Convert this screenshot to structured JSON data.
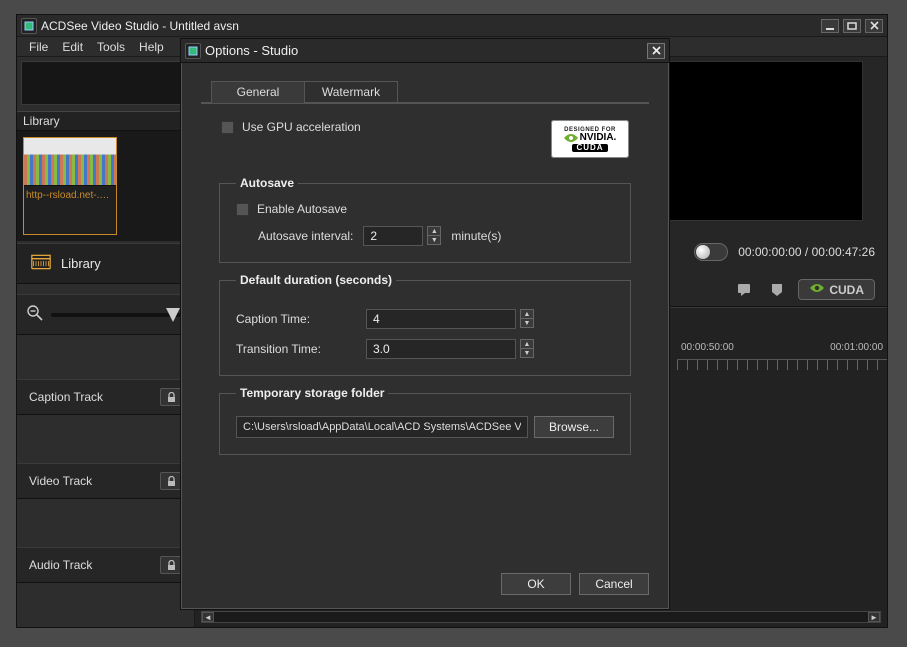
{
  "app": {
    "title": "ACDSee Video Studio - Untitled avsn"
  },
  "menubar": [
    "File",
    "Edit",
    "Tools",
    "Help"
  ],
  "library": {
    "header": "Library",
    "thumb_caption": "http--rsload.net-.m...",
    "tab_label": "Library"
  },
  "tracks": {
    "caption": "Caption Track",
    "video": "Video Track",
    "audio": "Audio Track"
  },
  "playback": {
    "time_display": "00:00:00:00 / 00:00:47:26"
  },
  "cuda_button": "CUDA",
  "timeline": {
    "tick_a": "00:00:50:00",
    "tick_b": "00:01:00:00"
  },
  "dialog": {
    "title": "Options - Studio",
    "tabs": {
      "general": "General",
      "watermark": "Watermark"
    },
    "gpu_label": "Use GPU acceleration",
    "nvidia": {
      "top": "DESIGNED FOR",
      "brand": "NVIDIA.",
      "sub": "CUDA"
    },
    "autosave": {
      "legend": "Autosave",
      "enable": "Enable Autosave",
      "interval_label": "Autosave interval:",
      "interval_value": "2",
      "unit": "minute(s)"
    },
    "duration": {
      "legend": "Default duration (seconds)",
      "caption_label": "Caption Time:",
      "caption_value": "4",
      "transition_label": "Transition Time:",
      "transition_value": "3.0"
    },
    "temp": {
      "legend": "Temporary storage folder",
      "path": "C:\\Users\\rsload\\AppData\\Local\\ACD Systems\\ACDSee Video S",
      "browse": "Browse..."
    },
    "buttons": {
      "ok": "OK",
      "cancel": "Cancel"
    }
  }
}
